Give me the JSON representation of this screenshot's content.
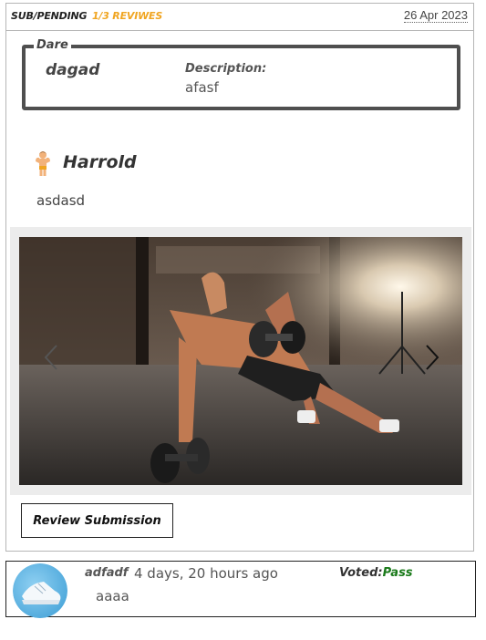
{
  "header": {
    "status": "SUB/PENDING",
    "reviews": "1/3 REVIWES",
    "date": "26 Apr 2023"
  },
  "dare": {
    "legend": "Dare",
    "name": "dagad",
    "description_label": "Description:",
    "description": "afasf"
  },
  "submission": {
    "user": "Harrold",
    "user_icon": "flexing-muscle-man-icon",
    "text": "asdasd"
  },
  "carousel": {
    "prev_icon": "chevron-left-icon",
    "next_icon": "chevron-right-icon"
  },
  "actions": {
    "review_label": "Review Submission"
  },
  "comment": {
    "user": "adfadf",
    "time": "4 days, 20 hours ago",
    "text": "aaaa",
    "vote_label": "Voted:",
    "vote_value": "Pass",
    "vote_color": "#1a7a1a"
  },
  "colors": {
    "accent": "#f0a521",
    "border": "#4f4f4f"
  }
}
